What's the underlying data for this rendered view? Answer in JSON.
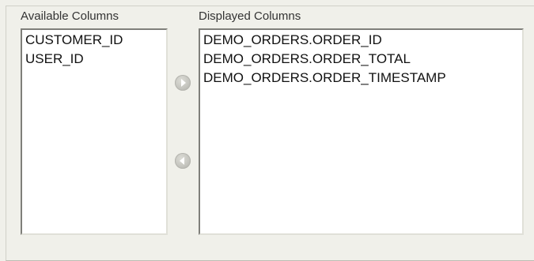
{
  "available": {
    "header": "Available Columns",
    "items": [
      "CUSTOMER_ID",
      "USER_ID"
    ]
  },
  "displayed": {
    "header": "Displayed Columns",
    "items": [
      "DEMO_ORDERS.ORDER_ID",
      "DEMO_ORDERS.ORDER_TOTAL",
      "DEMO_ORDERS.ORDER_TIMESTAMP"
    ]
  },
  "buttons": {
    "move_right_icon": "triangle-right",
    "move_left_icon": "triangle-left"
  },
  "colors": {
    "background": "#f0f0ea",
    "button": "#c3c3bd"
  }
}
